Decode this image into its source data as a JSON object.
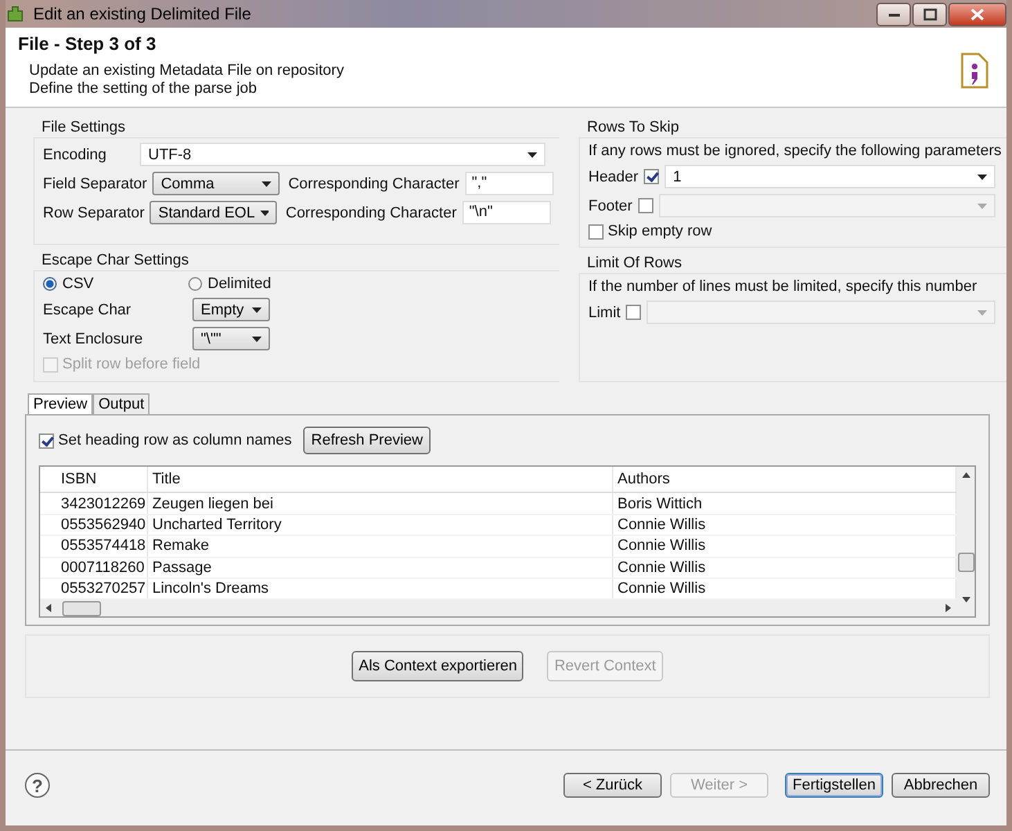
{
  "window": {
    "title": "Edit an existing Delimited File"
  },
  "header": {
    "title": "File - Step 3 of 3",
    "lines": [
      "Update an existing Metadata File on repository",
      "Define the setting of the parse job"
    ]
  },
  "file_settings": {
    "title": "File Settings",
    "encoding": {
      "label": "Encoding",
      "value": "UTF-8"
    },
    "field_separator": {
      "label": "Field Separator",
      "value": "Comma",
      "char_label": "Corresponding Character",
      "char_value": "\",\""
    },
    "row_separator": {
      "label": "Row Separator",
      "value": "Standard EOL",
      "char_label": "Corresponding Character",
      "char_value": "\"\\n\""
    }
  },
  "escape": {
    "title": "Escape Char Settings",
    "options": [
      {
        "label": "CSV",
        "selected": true
      },
      {
        "label": "Delimited",
        "selected": false
      }
    ],
    "escape_char": {
      "label": "Escape Char",
      "value": "Empty"
    },
    "text_enclosure": {
      "label": "Text Enclosure",
      "value": "\"\\\"\""
    },
    "split_row": {
      "label": "Split row before field",
      "checked": false,
      "disabled": true
    }
  },
  "rows_to_skip": {
    "title": "Rows To Skip",
    "hint": "If any rows must be ignored, specify the following parameters",
    "header": {
      "label": "Header",
      "checked": true,
      "value": "1"
    },
    "footer": {
      "label": "Footer",
      "checked": false
    },
    "skip_empty": {
      "label": "Skip empty row",
      "checked": false
    }
  },
  "limit": {
    "title": "Limit Of Rows",
    "hint": "If the number of lines must be limited, specify this number",
    "label": "Limit",
    "checked": false
  },
  "preview": {
    "tabs": [
      {
        "label": "Preview",
        "selected": true
      },
      {
        "label": "Output",
        "selected": false
      }
    ],
    "heading_checkbox": {
      "label": "Set heading row as column names",
      "checked": true
    },
    "refresh_button": "Refresh Preview",
    "columns": [
      "ISBN",
      "Title",
      "Authors"
    ],
    "rows": [
      [
        "3423012269",
        "Zeugen liegen bei",
        "Boris Wittich"
      ],
      [
        "0553562940",
        "Uncharted Territory",
        "Connie Willis"
      ],
      [
        "0553574418",
        "Remake",
        "Connie Willis"
      ],
      [
        "0007118260",
        "Passage",
        "Connie Willis"
      ],
      [
        "0553270257",
        "Lincoln's Dreams",
        "Connie Willis"
      ]
    ]
  },
  "context_buttons": [
    {
      "label": "Als Context exportieren",
      "disabled": false
    },
    {
      "label": "Revert Context",
      "disabled": true
    }
  ],
  "help": "?",
  "buttons": [
    {
      "label": "< Zurück",
      "disabled": false,
      "default": false
    },
    {
      "label": "Weiter >",
      "disabled": true,
      "default": false
    },
    {
      "label": "Fertigstellen",
      "disabled": false,
      "default": true
    },
    {
      "label": "Abbrechen",
      "disabled": false,
      "default": false
    }
  ]
}
